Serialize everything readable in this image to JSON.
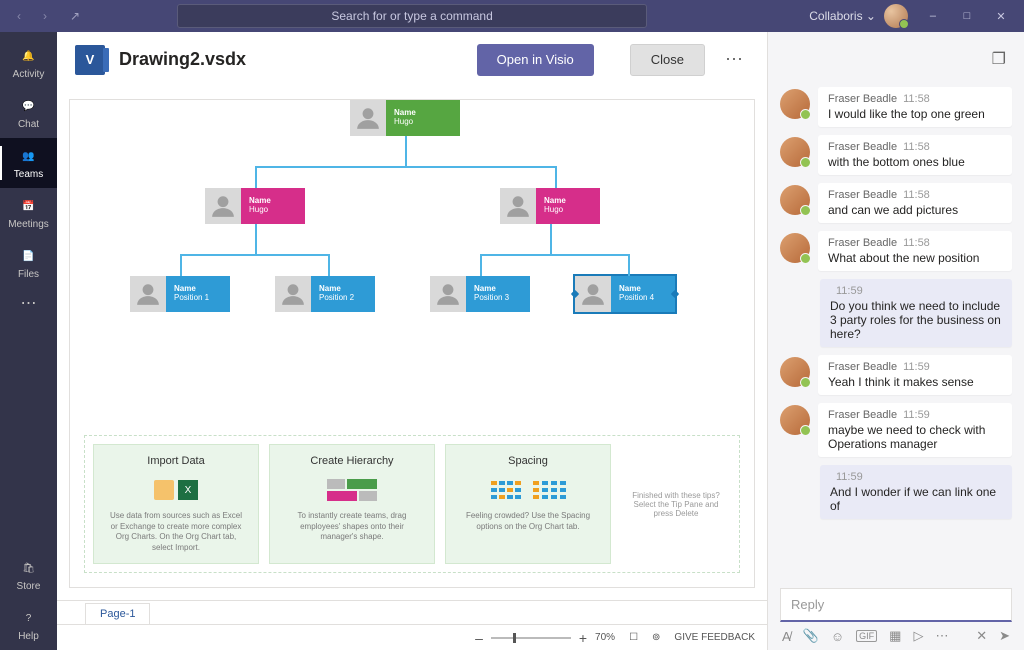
{
  "titlebar": {
    "search_placeholder": "Search for or type a command",
    "tenant": "Collaboris"
  },
  "rail": [
    {
      "icon": "bell",
      "label": "Activity"
    },
    {
      "icon": "chat",
      "label": "Chat"
    },
    {
      "icon": "teams",
      "label": "Teams"
    },
    {
      "icon": "calendar",
      "label": "Meetings"
    },
    {
      "icon": "files",
      "label": "Files"
    }
  ],
  "rail_bottom": [
    {
      "icon": "store",
      "label": "Store"
    },
    {
      "icon": "help",
      "label": "Help"
    }
  ],
  "file": {
    "icon_letter": "V",
    "name": "Drawing2.vsdx",
    "open_label": "Open in Visio",
    "close_label": "Close",
    "sheet": "Page-1",
    "zoom": "70%",
    "feedback": "GIVE FEEDBACK"
  },
  "chart_data": {
    "type": "orgchart",
    "nodes": [
      {
        "id": "root",
        "line1": "Name",
        "line2": "Hugo",
        "color": "green",
        "parent": null
      },
      {
        "id": "m1",
        "line1": "Name",
        "line2": "Hugo",
        "color": "magenta",
        "parent": "root"
      },
      {
        "id": "m2",
        "line1": "Name",
        "line2": "Hugo",
        "color": "magenta",
        "parent": "root"
      },
      {
        "id": "p1",
        "line1": "Name",
        "line2": "Position 1",
        "color": "sky",
        "parent": "m1"
      },
      {
        "id": "p2",
        "line1": "Name",
        "line2": "Position 2",
        "color": "sky",
        "parent": "m1"
      },
      {
        "id": "p3",
        "line1": "Name",
        "line2": "Position 3",
        "color": "sky",
        "parent": "m2"
      },
      {
        "id": "p4",
        "line1": "Name",
        "line2": "Position 4",
        "color": "sky",
        "parent": "m2",
        "selected": true
      }
    ]
  },
  "tips": {
    "cards": [
      {
        "title": "Import Data",
        "desc": "Use data from sources such as Excel or Exchange to create more complex Org Charts. On the Org Chart tab, select Import."
      },
      {
        "title": "Create Hierarchy",
        "desc": "To instantly create teams, drag employees' shapes onto their manager's shape."
      },
      {
        "title": "Spacing",
        "desc": "Feeling crowded? Use the Spacing options on the Org Chart tab."
      }
    ],
    "finish": "Finished with these tips? Select the Tip Pane and press Delete"
  },
  "chat": {
    "messages": [
      {
        "from": "Fraser Beadle",
        "time": "11:58",
        "text": "I would like the top one green",
        "me": false
      },
      {
        "from": "Fraser Beadle",
        "time": "11:58",
        "text": "with the bottom ones blue",
        "me": false
      },
      {
        "from": "Fraser Beadle",
        "time": "11:58",
        "text": "and can we add pictures",
        "me": false
      },
      {
        "from": "Fraser Beadle",
        "time": "11:58",
        "text": "What about the new position",
        "me": false
      },
      {
        "from": "",
        "time": "11:59",
        "text": "Do you think we need to include 3 party roles for the business on here?",
        "me": true
      },
      {
        "from": "Fraser Beadle",
        "time": "11:59",
        "text": "Yeah I think it makes sense",
        "me": false
      },
      {
        "from": "Fraser Beadle",
        "time": "11:59",
        "text": "maybe we need to check with Operations manager",
        "me": false
      },
      {
        "from": "",
        "time": "11:59",
        "text": "And I wonder if we can link one of",
        "me": true
      }
    ],
    "reply_placeholder": "Reply"
  }
}
